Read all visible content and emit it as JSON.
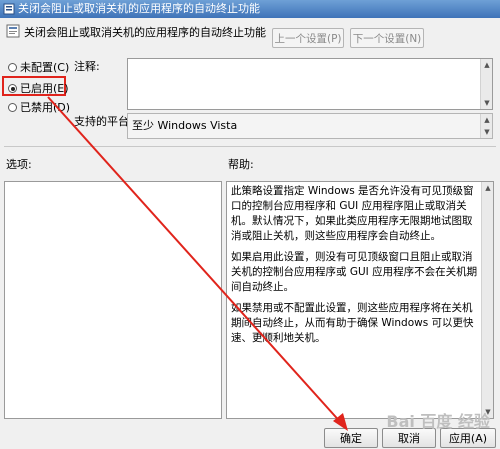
{
  "window": {
    "title": "关闭会阻止或取消关机的应用程序的自动终止功能",
    "icon": "policy-icon"
  },
  "header": {
    "policy_name": "关闭会阻止或取消关机的应用程序的自动终止功能",
    "prev_setting": "上一个设置(P)",
    "next_setting": "下一个设置(N)"
  },
  "state": {
    "options": [
      {
        "label": "未配置(C)",
        "selected": false
      },
      {
        "label": "已启用(E)",
        "selected": true
      },
      {
        "label": "已禁用(D)",
        "selected": false
      }
    ]
  },
  "comment": {
    "label": "注释:",
    "value": ""
  },
  "platform": {
    "label": "支持的平台:",
    "value": "至少 Windows Vista"
  },
  "options_panel": {
    "label": "选项:"
  },
  "help": {
    "label": "帮助:",
    "paragraphs": [
      "此策略设置指定 Windows 是否允许没有可见顶级窗口的控制台应用程序和 GUI 应用程序阻止或取消关机。默认情况下，如果此类应用程序无限期地试图取消或阻止关机，则这些应用程序会自动终止。",
      "如果启用此设置，则没有可见顶级窗口且阻止或取消关机的控制台应用程序或 GUI 应用程序不会在关机期间自动终止。",
      "如果禁用或不配置此设置，则这些应用程序将在关机期间自动终止，从而有助于确保 Windows 可以更快速、更顺利地关机。"
    ]
  },
  "footer": {
    "ok": "确定",
    "cancel": "取消",
    "apply": "应用(A)"
  },
  "annotation": {
    "color": "#e0241c"
  },
  "watermark": "Bai 百度 经验"
}
